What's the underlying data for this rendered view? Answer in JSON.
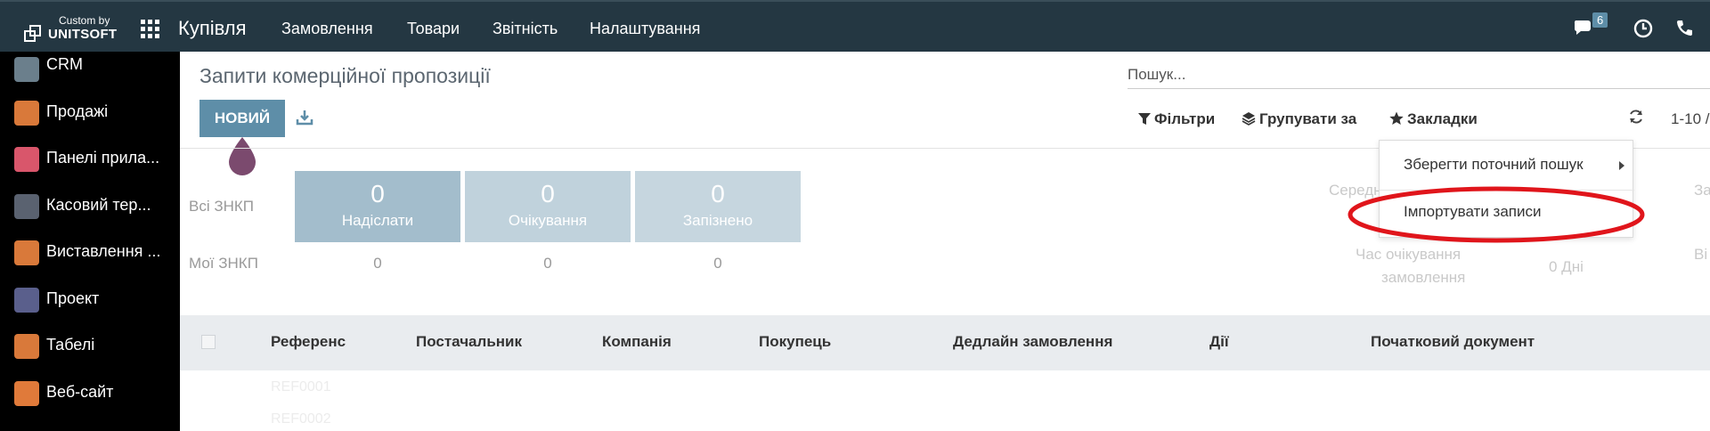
{
  "header": {
    "logo_top": "Custom by",
    "logo_brand": "UNITSOFT",
    "app_title": "Купівля",
    "menu": [
      "Замовлення",
      "Товари",
      "Звітність",
      "Налаштування"
    ],
    "chat_badge": "6"
  },
  "sidebar": {
    "items": [
      {
        "label": "CRM",
        "color": "#6b7f8c"
      },
      {
        "label": "Продажі",
        "color": "#d9793a"
      },
      {
        "label": "Панелі прила...",
        "color": "#d9566b"
      },
      {
        "label": "Касовий тер...",
        "color": "#5a6270"
      },
      {
        "label": "Виставлення ...",
        "color": "#d9793a"
      },
      {
        "label": "Проект",
        "color": "#5a5f8c"
      },
      {
        "label": "Табелі",
        "color": "#d9793a"
      },
      {
        "label": "Веб-сайт",
        "color": "#e07a3a"
      }
    ]
  },
  "page": {
    "title": "Запити комерційної пропозиції",
    "new_button": "НОВИЙ",
    "search_placeholder": "Пошук...",
    "filters": "Фільтри",
    "group_by": "Групувати за",
    "bookmarks": "Закладки",
    "pager": "1-10 /"
  },
  "dashboard": {
    "all_label": "Всі ЗНКП",
    "my_label": "Мої ЗНКП",
    "tiles": [
      {
        "count": "0",
        "label": "Надіслати",
        "my": "0"
      },
      {
        "count": "0",
        "label": "Очікування",
        "my": "0"
      },
      {
        "count": "0",
        "label": "Запізнено",
        "my": "0"
      }
    ],
    "faded_avg": "Середн",
    "faded_lead_time_1": "Час очікування",
    "faded_lead_time_2": "замовлення",
    "faded_days": "0 Дні",
    "faded_right_1": "За",
    "faded_right_2": "Ві"
  },
  "table": {
    "columns": [
      "Референс",
      "Постачальник",
      "Компанія",
      "Покупець",
      "Дедлайн замовлення",
      "Дії",
      "Початковий документ"
    ],
    "ghost_rows": [
      "REF0001",
      "REF0002"
    ]
  },
  "bookmarks_menu": {
    "save_current": "Зберегти поточний пошук",
    "import_records": "Імпортувати записи"
  },
  "colors": {
    "topbar": "#243742",
    "accent": "#5e8ea8",
    "tile": "#a3bdcc",
    "highlight": "#e0151b"
  }
}
